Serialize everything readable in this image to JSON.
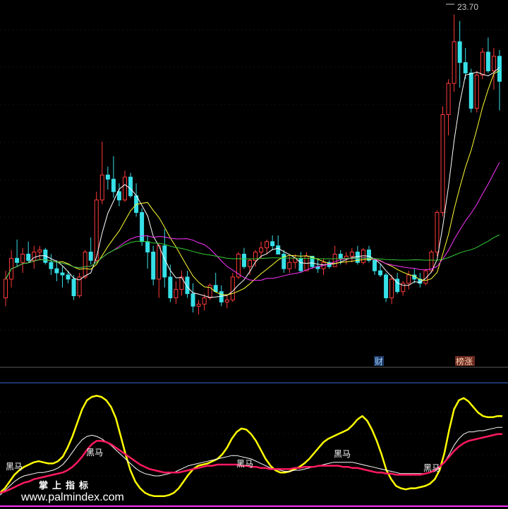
{
  "chart_data": [
    {
      "type": "candlestick",
      "title": "",
      "price_label": "23.70",
      "ylim": [
        9.0,
        24.2
      ],
      "colors": {
        "up": "#ff3a3a",
        "down": "#36e0e8",
        "ma5": "#ffffff",
        "ma10": "#ffff33",
        "ma20": "#ff33ff",
        "ma60": "#33cc33"
      },
      "candles": [
        [
          10.1,
          11.4,
          9.7,
          11.0
        ],
        [
          11.0,
          12.4,
          10.6,
          12.0
        ],
        [
          12.0,
          12.9,
          11.6,
          11.8
        ],
        [
          11.8,
          12.5,
          11.3,
          12.2
        ],
        [
          12.2,
          12.8,
          11.8,
          11.9
        ],
        [
          11.9,
          12.6,
          11.5,
          12.3
        ],
        [
          12.3,
          12.6,
          11.9,
          12.4
        ],
        [
          12.4,
          12.5,
          11.7,
          11.8
        ],
        [
          11.8,
          12.2,
          11.2,
          11.5
        ],
        [
          11.5,
          11.9,
          10.9,
          11.3
        ],
        [
          11.3,
          11.6,
          10.6,
          11.2
        ],
        [
          11.2,
          11.4,
          10.8,
          11.0
        ],
        [
          11.0,
          11.2,
          10.0,
          10.2
        ],
        [
          10.2,
          11.3,
          10.1,
          11.1
        ],
        [
          11.1,
          12.4,
          11.0,
          12.3
        ],
        [
          12.3,
          13.0,
          11.7,
          11.9
        ],
        [
          11.9,
          15.2,
          11.8,
          14.8
        ],
        [
          14.8,
          17.6,
          14.6,
          16.0
        ],
        [
          16.0,
          16.4,
          15.3,
          15.8
        ],
        [
          15.8,
          16.9,
          14.9,
          15.2
        ],
        [
          15.2,
          15.6,
          14.5,
          14.8
        ],
        [
          14.8,
          16.2,
          14.7,
          15.9
        ],
        [
          15.9,
          16.1,
          14.9,
          15.0
        ],
        [
          15.0,
          15.6,
          14.0,
          14.2
        ],
        [
          14.2,
          14.4,
          12.6,
          12.8
        ],
        [
          12.8,
          13.1,
          11.5,
          12.3
        ],
        [
          12.3,
          12.6,
          10.7,
          11.0
        ],
        [
          11.0,
          12.7,
          10.1,
          12.6
        ],
        [
          12.6,
          13.4,
          10.6,
          11.1
        ],
        [
          11.1,
          11.7,
          9.9,
          10.1
        ],
        [
          10.1,
          10.9,
          9.8,
          10.5
        ],
        [
          10.5,
          11.4,
          10.2,
          11.1
        ],
        [
          11.1,
          11.4,
          10.1,
          10.3
        ],
        [
          10.3,
          10.8,
          9.4,
          9.7
        ],
        [
          9.7,
          10.0,
          9.3,
          9.8
        ],
        [
          9.8,
          10.3,
          9.5,
          10.1
        ],
        [
          10.1,
          10.8,
          10.0,
          10.7
        ],
        [
          10.7,
          11.3,
          10.4,
          10.4
        ],
        [
          10.4,
          10.7,
          9.7,
          9.9
        ],
        [
          9.9,
          10.2,
          9.6,
          10.0
        ],
        [
          10.0,
          11.3,
          9.9,
          11.1
        ],
        [
          11.1,
          12.3,
          11.0,
          12.2
        ],
        [
          12.2,
          12.5,
          11.5,
          11.6
        ],
        [
          11.6,
          12.0,
          11.2,
          11.9
        ],
        [
          11.9,
          12.4,
          11.6,
          12.3
        ],
        [
          12.3,
          12.8,
          12.0,
          12.5
        ],
        [
          12.5,
          12.9,
          12.2,
          12.8
        ],
        [
          12.8,
          13.1,
          12.4,
          12.6
        ],
        [
          12.6,
          13.1,
          12.2,
          12.2
        ],
        [
          12.2,
          12.4,
          11.3,
          11.5
        ],
        [
          11.5,
          12.1,
          11.3,
          11.8
        ],
        [
          11.8,
          12.2,
          11.5,
          12.0
        ],
        [
          12.0,
          12.3,
          11.3,
          11.4
        ],
        [
          11.4,
          12.3,
          11.4,
          12.1
        ],
        [
          12.1,
          12.1,
          11.5,
          11.6
        ],
        [
          11.6,
          12.0,
          11.3,
          11.5
        ],
        [
          11.5,
          12.0,
          11.2,
          11.8
        ],
        [
          11.8,
          11.9,
          11.5,
          11.6
        ],
        [
          11.6,
          12.6,
          11.6,
          12.2
        ],
        [
          12.2,
          12.4,
          11.7,
          12.0
        ],
        [
          12.0,
          12.3,
          11.7,
          12.1
        ],
        [
          12.1,
          12.5,
          11.8,
          12.3
        ],
        [
          12.3,
          12.6,
          11.7,
          11.8
        ],
        [
          11.8,
          12.5,
          11.7,
          12.4
        ],
        [
          12.4,
          12.6,
          11.8,
          11.9
        ],
        [
          11.9,
          12.0,
          11.2,
          11.4
        ],
        [
          11.4,
          11.7,
          11.1,
          11.2
        ],
        [
          11.2,
          11.3,
          9.9,
          10.1
        ],
        [
          10.1,
          11.2,
          9.8,
          11.0
        ],
        [
          11.0,
          11.3,
          10.3,
          10.4
        ],
        [
          10.4,
          10.9,
          10.2,
          10.8
        ],
        [
          10.8,
          11.4,
          10.5,
          11.2
        ],
        [
          11.2,
          11.5,
          10.8,
          11.0
        ],
        [
          11.0,
          11.3,
          10.6,
          10.8
        ],
        [
          10.8,
          11.5,
          10.7,
          11.4
        ],
        [
          11.4,
          12.4,
          11.3,
          12.3
        ],
        [
          12.3,
          14.3,
          12.1,
          14.2
        ],
        [
          14.2,
          19.3,
          14.0,
          18.9
        ],
        [
          18.9,
          20.6,
          17.9,
          20.4
        ],
        [
          20.4,
          23.7,
          20.0,
          22.4
        ],
        [
          22.4,
          23.4,
          20.2,
          21.4
        ],
        [
          21.4,
          22.1,
          20.6,
          20.9
        ],
        [
          20.9,
          21.1,
          19.0,
          19.2
        ],
        [
          19.2,
          21.0,
          19.0,
          20.8
        ],
        [
          20.8,
          22.1,
          20.6,
          21.9
        ],
        [
          21.9,
          22.6,
          20.9,
          21.0
        ],
        [
          21.0,
          22.1,
          20.1,
          21.7
        ],
        [
          21.7,
          22.0,
          19.1,
          20.5
        ]
      ]
    },
    {
      "type": "line",
      "title": "",
      "ylim": [
        0,
        100
      ],
      "series": [
        {
          "color": "#ffff00",
          "values": [
            10,
            14,
            20,
            26,
            30,
            33,
            35,
            37,
            38,
            37,
            36,
            36,
            38,
            42,
            50,
            60,
            72,
            84,
            92,
            95,
            96,
            95,
            92,
            86,
            76,
            60,
            44,
            30,
            20,
            14,
            10,
            8,
            7,
            7,
            7,
            8,
            10,
            14,
            20,
            26,
            31,
            34,
            35,
            36,
            38,
            40,
            44,
            50,
            58,
            64,
            67,
            66,
            62,
            56,
            48,
            40,
            34,
            30,
            28,
            28,
            29,
            31,
            33,
            36,
            40,
            45,
            50,
            55,
            58,
            60,
            62,
            64,
            66,
            70,
            75,
            78,
            74,
            66,
            56,
            44,
            30,
            22,
            16,
            14,
            13,
            14,
            14,
            15,
            16,
            18,
            22,
            30,
            45,
            66,
            84,
            92,
            94,
            91,
            86,
            81,
            78,
            77,
            77,
            78,
            78
          ]
        },
        {
          "color": "#ffffff",
          "values": [
            8,
            12,
            16,
            20,
            23,
            25,
            26,
            27,
            28,
            28,
            29,
            30,
            32,
            35,
            40,
            46,
            52,
            57,
            60,
            61,
            60,
            58,
            55,
            52,
            48,
            44,
            40,
            36,
            32,
            29,
            27,
            26,
            25,
            25,
            26,
            27,
            28,
            30,
            32,
            34,
            35,
            36,
            37,
            38,
            39,
            40,
            41,
            42,
            43,
            43,
            42,
            41,
            40,
            38,
            36,
            34,
            32,
            31,
            30,
            29,
            29,
            30,
            30,
            31,
            32,
            33,
            34,
            35,
            36,
            37,
            37,
            37,
            37,
            37,
            36,
            35,
            34,
            33,
            32,
            31,
            30,
            29,
            28,
            27,
            27,
            27,
            27,
            27,
            27,
            28,
            29,
            32,
            37,
            44,
            52,
            58,
            62,
            64,
            64,
            65,
            65,
            66,
            67,
            68,
            68
          ]
        },
        {
          "color": "#ff1a60",
          "values": [
            10,
            11,
            13,
            15,
            17,
            19,
            20,
            22,
            23,
            24,
            25,
            26,
            27,
            28,
            30,
            33,
            37,
            42,
            48,
            53,
            56,
            56,
            55,
            53,
            50,
            47,
            44,
            41,
            38,
            35,
            33,
            31,
            30,
            29,
            28,
            28,
            28,
            28,
            29,
            30,
            31,
            32,
            33,
            34,
            34,
            35,
            35,
            35,
            35,
            35,
            34,
            34,
            33,
            33,
            32,
            32,
            31,
            31,
            31,
            31,
            31,
            32,
            32,
            33,
            33,
            33,
            34,
            34,
            34,
            34,
            34,
            33,
            33,
            32,
            32,
            31,
            30,
            29,
            28,
            28,
            27,
            27,
            26,
            26,
            26,
            26,
            26,
            26,
            27,
            28,
            30,
            33,
            37,
            42,
            47,
            51,
            54,
            56,
            57,
            58,
            59,
            60,
            61,
            62,
            62
          ]
        }
      ]
    }
  ],
  "labels": {
    "top_price": "23.70",
    "badge_cai": "财",
    "badge_bangzhang": "榜涨",
    "heima": "黑马",
    "watermark_cn": "掌上指标",
    "watermark_url": "www.palmindex.com"
  }
}
